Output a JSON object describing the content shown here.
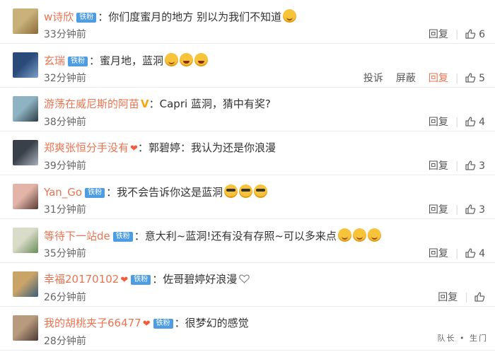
{
  "comments": [
    {
      "user": "w诗欣",
      "badge": "铁粉",
      "vip": false,
      "heart": false,
      "text": "你们度蜜月的地方 别以为我们不知道",
      "emojis": [
        "smile"
      ],
      "time": "33分钟前",
      "actions": [
        "回复"
      ],
      "likes": "6",
      "avatar": [
        "#c9b27a",
        "#8a6b3a"
      ]
    },
    {
      "user": "玄瑞",
      "badge": "铁粉",
      "vip": false,
      "heart": false,
      "text": "蜜月地，蓝洞",
      "emojis": [
        "smile",
        "laugh",
        "laugh"
      ],
      "time": "32分钟前",
      "actions": [
        "投诉",
        "屏蔽",
        "回复"
      ],
      "likes": "5",
      "avatar": [
        "#2a4a7a",
        "#7aa0c8"
      ]
    },
    {
      "user": "游荡在威尼斯的阿苗",
      "badge": "",
      "vip": true,
      "heart": false,
      "text": "Capri 蓝洞，猜中有奖?",
      "emojis": [],
      "time": "38分钟前",
      "actions": [
        "回复"
      ],
      "likes": "4",
      "avatar": [
        "#8fb3c2",
        "#2d3e46"
      ]
    },
    {
      "user": "郑爽张恒分手没有",
      "badge": "",
      "vip": false,
      "heart": true,
      "text": "郭碧婷：我认为还是你浪漫",
      "emojis": [],
      "time": "39分钟前",
      "actions": [
        "回复"
      ],
      "likes": "3",
      "avatar": [
        "#39404a",
        "#a9b3bd"
      ]
    },
    {
      "user": "Yan_Go",
      "badge": "铁粉",
      "vip": false,
      "heart": false,
      "text": "我不会告诉你这是蓝洞",
      "emojis": [
        "cool",
        "cool",
        "cool"
      ],
      "time": "31分钟前",
      "actions": [
        "回复"
      ],
      "likes": "3",
      "avatar": [
        "#e3b5a9",
        "#5a3a34"
      ]
    },
    {
      "user": "等待下一站de",
      "badge": "铁粉",
      "vip": false,
      "heart": false,
      "text": "意大利~蓝洞!还有没有存照~可以多来点",
      "emojis": [
        "smile",
        "smile",
        "smile"
      ],
      "time": "35分钟前",
      "actions": [
        "回复"
      ],
      "likes": "4",
      "avatar": [
        "#d9dcc9",
        "#6b8c59"
      ]
    },
    {
      "user": "幸福20170102",
      "badge": "铁粉",
      "vip": false,
      "heart": true,
      "text": "佐哥碧婷好浪漫",
      "emojis": [
        "heart-outline"
      ],
      "time": "26分钟前",
      "actions": [
        "回复"
      ],
      "likes": "",
      "avatar": [
        "#c8a469",
        "#3b5d78"
      ]
    },
    {
      "user": "我的胡桃夹子66477",
      "badge": "铁粉",
      "vip": false,
      "heart": true,
      "text": "很梦幻的感觉",
      "emojis": [],
      "time": "28分钟前",
      "actions": [],
      "likes": "",
      "avatar": [
        "#b89a7e",
        "#4a3a32"
      ]
    }
  ],
  "colon": "：",
  "watermark": "队长 • 生门"
}
